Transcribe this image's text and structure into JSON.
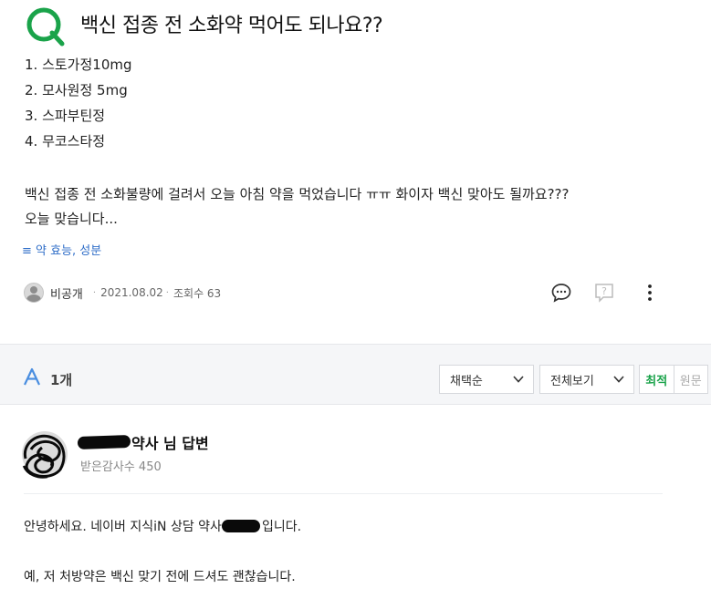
{
  "question": {
    "title": "백신 접종 전 소화약 먹어도 되나요??",
    "list": [
      "1. 스토가정10mg",
      "2. 모사원정 5mg",
      "3. 스파부틴정",
      "4. 무코스타정"
    ],
    "body_line1": "백신 접종 전 소화불량에 걸려서 오늘 아침 약을 먹었습니다 ㅠㅠ 화이자 백신 맞아도 될까요???",
    "body_line2": "오늘 맞습니다...",
    "tag": "≡ 약 효능, 성분",
    "author": "비공개",
    "date": "2021.08.02",
    "views": "조회수 63",
    "icons": {
      "logo": "q-logo-icon",
      "comment": "comment-icon",
      "ask": "question-box-icon",
      "more": "more-vertical-icon"
    }
  },
  "answer_bar": {
    "count": "1개",
    "sort_label": "채택순",
    "view_label": "전체보기",
    "toggle_latest": "최적",
    "toggle_original": "원문"
  },
  "answer": {
    "name_suffix": "약사 님 답변",
    "thanks": "받은감사수 450",
    "line1_before": "안녕하세요. 네이버 지식iN 상담 약사 ",
    "line1_after": " 입니다.",
    "line2": "예, 저 처방약은 백신 맞기 전에 드셔도 괜찮습니다."
  },
  "colors": {
    "brand_green": "#1aa34a",
    "answer_blue": "#4a8ee0",
    "link_blue": "#2f6ec8",
    "bar_bg": "#f5f6f8"
  }
}
